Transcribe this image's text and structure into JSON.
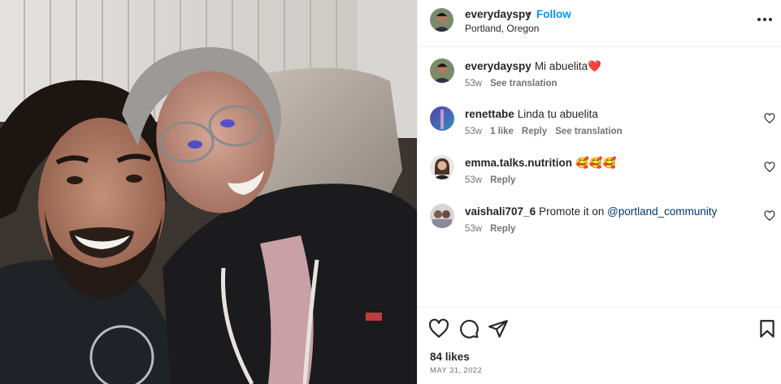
{
  "post": {
    "username": "everydayspy",
    "separator": "•",
    "follow_label": "Follow",
    "location": "Portland, Oregon",
    "more_icon": "more-horizontal-icon"
  },
  "caption": {
    "username": "everydayspy",
    "text": "Mi abuelita",
    "emoji": "❤️",
    "time": "53w",
    "translate_label": "See translation"
  },
  "comments": [
    {
      "username": "renettabe",
      "text": "Linda tu abuelita",
      "time": "53w",
      "likes": "1 like",
      "reply_label": "Reply",
      "translate_label": "See translation"
    },
    {
      "username": "emma.talks.nutrition",
      "text": "🥰🥰🥰",
      "time": "53w",
      "reply_label": "Reply"
    },
    {
      "username": "vaishali707_6",
      "text": "Promote it on ",
      "mention": "@portland_community",
      "time": "53w",
      "reply_label": "Reply"
    }
  ],
  "footer": {
    "likes": "84 likes",
    "date": "MAY 31, 2022"
  },
  "colors": {
    "accent": "#0095f6",
    "mention": "#00376b",
    "secondary_text": "#737373",
    "heart": "#d93a4a"
  }
}
